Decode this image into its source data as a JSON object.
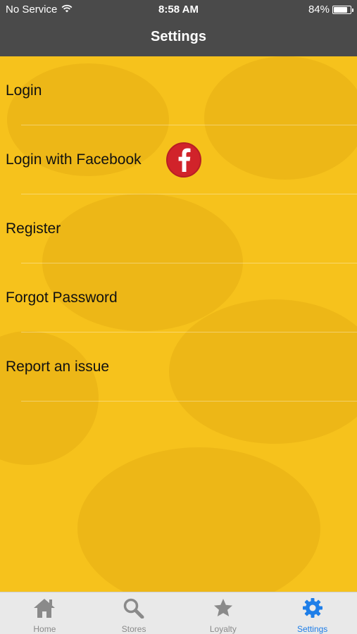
{
  "status": {
    "carrier": "No Service",
    "time": "8:58 AM",
    "battery": "84%",
    "battery_level": 0.84
  },
  "navbar": {
    "title": "Settings"
  },
  "menu": {
    "items": [
      {
        "label": "Login"
      },
      {
        "label": "Login with Facebook"
      },
      {
        "label": "Register"
      },
      {
        "label": "Forgot Password"
      },
      {
        "label": "Report an issue"
      }
    ]
  },
  "tabs": [
    {
      "label": "Home",
      "icon": "home-icon",
      "active": false
    },
    {
      "label": "Stores",
      "icon": "search-icon",
      "active": false
    },
    {
      "label": "Loyalty",
      "icon": "star-icon",
      "active": false
    },
    {
      "label": "Settings",
      "icon": "gear-icon",
      "active": true
    }
  ],
  "colors": {
    "background": "#f6c21c",
    "bars": "#4a4a4a",
    "tabbar": "#e9e9e9",
    "accent": "#1e7ee8",
    "facebook_badge": "#d1232a"
  }
}
